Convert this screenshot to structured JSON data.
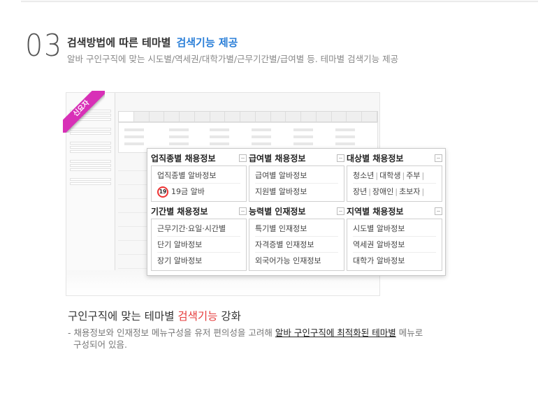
{
  "section": {
    "number": "03",
    "title": "검색방법에 따른 테마별",
    "title_accent": "검색기능 제공",
    "subtitle": "알바 구인구직에 맞는 시도별/역세권/대학가별/근무기간별/급여별 등.  테마별 검색기능 제공"
  },
  "ribbon": {
    "label": "신요자"
  },
  "popup": {
    "categories": [
      {
        "title": "업직종별 채용정보",
        "items": [
          "업직종별 알바정보",
          "19금 알바"
        ]
      },
      {
        "title": "급여별 채용정보",
        "items": [
          "급여별 알바정보",
          "지원별 알바정보"
        ]
      },
      {
        "title": "대상별 채용정보",
        "items": [
          "청소년",
          "대학생",
          "주부",
          "장년",
          "장애인",
          "초보자"
        ]
      },
      {
        "title": "기간별 채용정보",
        "items": [
          "근무기간·요일·시간별",
          "단기 알바정보",
          "장기 알바정보"
        ]
      },
      {
        "title": "능력별 인재정보",
        "items": [
          "특기별 인재정보",
          "자격증별 인재정보",
          "외국어가능 인재정보"
        ]
      },
      {
        "title": "지역별 채용정보",
        "items": [
          "시도별 알바정보",
          "역세권 알바정보",
          "대학가 알바정보"
        ]
      }
    ],
    "age_badge": "19"
  },
  "footer": {
    "headline_prefix": "구인구직에 맞는 테마별",
    "headline_accent": "검색기능",
    "headline_suffix": "강화",
    "desc_prefix": "- 채용정보와 인재정보 메뉴구성을 유저 편의성을 고려해",
    "desc_link": "알바 구인구직에 최적화된 테마별",
    "desc_suffix": " 메뉴로",
    "desc_line2": "구성되어 있음."
  },
  "colors": {
    "accent_blue": "#2b7fd8",
    "accent_red": "#e53a3a",
    "ribbon": "#d830b7"
  }
}
